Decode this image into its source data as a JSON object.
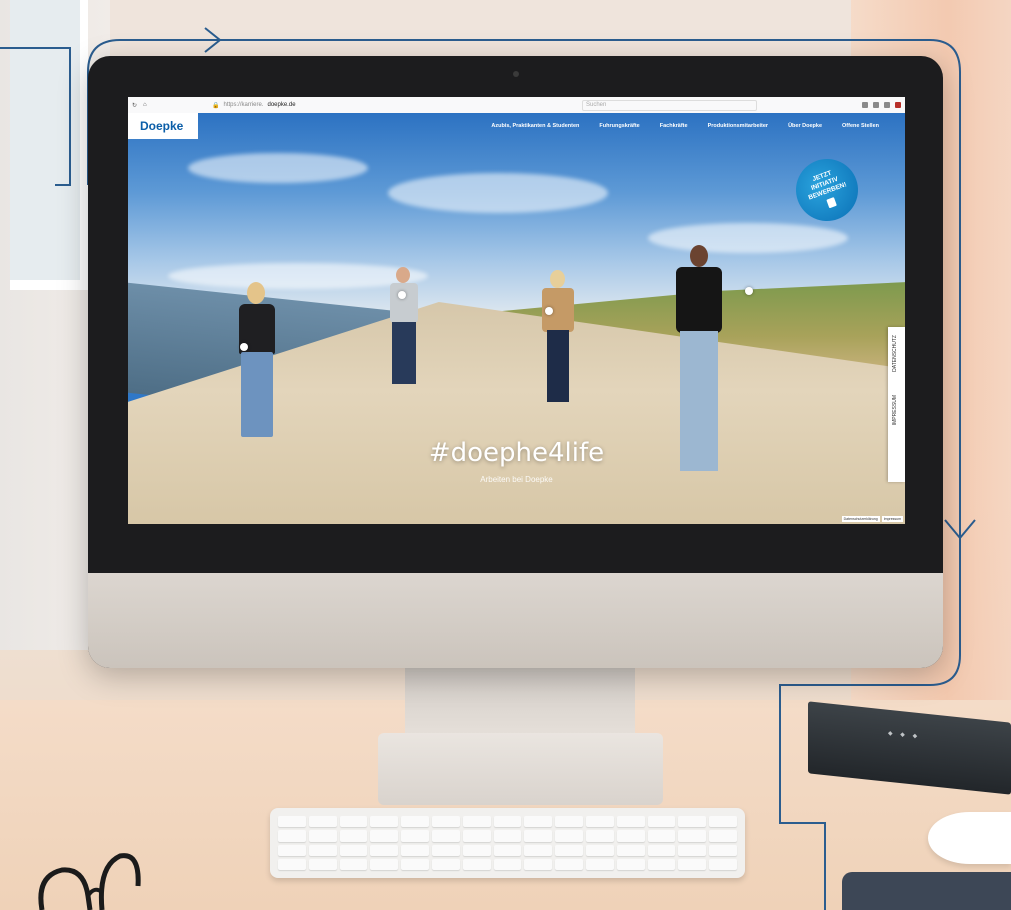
{
  "browser": {
    "url_prefix": "https://karriere.",
    "url_domain": "doepke.de",
    "search_placeholder": "Suchen"
  },
  "site": {
    "logo": "Doepke",
    "nav": [
      "Azubis, Praktikanten & Studenten",
      "Fuhrungskräfte",
      "Fachkräfte",
      "Produktionsmitarbeiter",
      "Über Doepke",
      "Offene Stellen"
    ],
    "badge_lines": [
      "JETZT",
      "INITIATIV",
      "BEWERBEN!"
    ],
    "side_tab": [
      "DATENSCHUTZ",
      "IMPRESSUM"
    ],
    "hero_title": "#doephe4life",
    "hero_subtitle": "Arbeiten bei Doepke",
    "footer_links": [
      "Datenschutzerklärung",
      "Impressum"
    ]
  },
  "colors": {
    "brand_blue": "#0b5ea8",
    "line_blue": "#2b5d8f",
    "badge_blue": "#1a8fcf"
  }
}
